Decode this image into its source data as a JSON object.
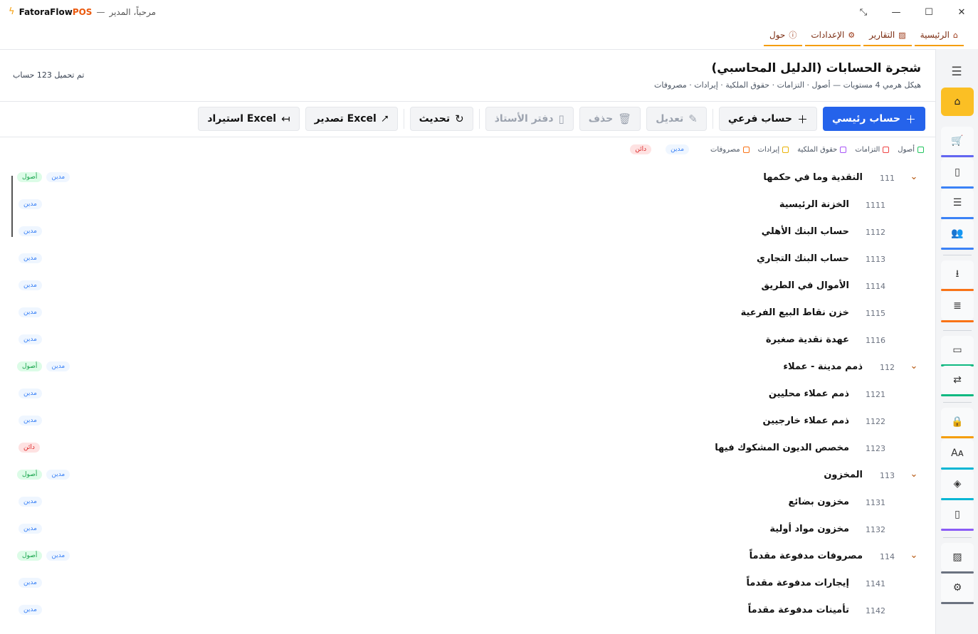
{
  "titlebar": {
    "app_name_1": "FatoraFlow",
    "app_name_2": "POS",
    "dash": "—",
    "welcome": "مرحباً، المدير",
    "controls": {
      "restore": "⤡",
      "minimize": "—",
      "maximize": "☐",
      "close": "✕"
    }
  },
  "menubar": [
    {
      "label": "الرئيسية",
      "icon": "⌂",
      "icon_name": "home-icon"
    },
    {
      "label": "التقارير",
      "icon": "▨",
      "icon_name": "report-icon"
    },
    {
      "label": "الإعدادات",
      "icon": "⚙",
      "icon_name": "gear-icon"
    },
    {
      "label": "حول",
      "icon": "ⓘ",
      "icon_name": "info-icon"
    }
  ],
  "page": {
    "title": "شجرة الحسابات (الدليل المحاسبي)",
    "subtitle": "هيكل هرمي 4 مستويات — أصول · التزامات · حقوق الملكية · إيرادات · مصروفات",
    "loaded_count": "تم تحميل 123 حساب"
  },
  "toolbar": {
    "add_main": "حساب رئيسي",
    "add_sub": "حساب فرعي",
    "edit": "تعديل",
    "delete": "حذف",
    "ledger": "دفتر الأستاذ",
    "refresh": "تحديث",
    "export": "تصدير Excel",
    "import": "استيراد Excel"
  },
  "legend": {
    "assets": "أصول",
    "liabilities": "التزامات",
    "equity": "حقوق الملكية",
    "revenue": "إيرادات",
    "expenses": "مصروفات",
    "debit": "مدين",
    "credit": "دائن",
    "colors": {
      "assets": "#22c55e",
      "liabilities": "#ef4444",
      "equity": "#a855f7",
      "revenue": "#eab308",
      "expenses": "#f97316"
    }
  },
  "accounts": [
    {
      "code": "111",
      "name": "النقدية وما في حكمها",
      "level": "group",
      "nature": "مدين",
      "type": "أصول"
    },
    {
      "code": "1111",
      "name": "الخزنة الرئيسية",
      "level": "sub",
      "nature": "مدين"
    },
    {
      "code": "1112",
      "name": "حساب البنك الأهلي",
      "level": "sub",
      "nature": "مدين"
    },
    {
      "code": "1113",
      "name": "حساب البنك التجاري",
      "level": "sub",
      "nature": "مدين"
    },
    {
      "code": "1114",
      "name": "الأموال في الطريق",
      "level": "sub",
      "nature": "مدين"
    },
    {
      "code": "1115",
      "name": "خزن نقاط البيع الفرعية",
      "level": "sub",
      "nature": "مدين"
    },
    {
      "code": "1116",
      "name": "عهدة نقدية صغيرة",
      "level": "sub",
      "nature": "مدين"
    },
    {
      "code": "112",
      "name": "ذمم مدينة - عملاء",
      "level": "group",
      "nature": "مدين",
      "type": "أصول"
    },
    {
      "code": "1121",
      "name": "ذمم عملاء محليين",
      "level": "sub",
      "nature": "مدين"
    },
    {
      "code": "1122",
      "name": "ذمم عملاء خارجيين",
      "level": "sub",
      "nature": "مدين"
    },
    {
      "code": "1123",
      "name": "مخصص الديون المشكوك فيها",
      "level": "sub",
      "nature": "دائن"
    },
    {
      "code": "113",
      "name": "المخزون",
      "level": "group",
      "nature": "مدين",
      "type": "أصول"
    },
    {
      "code": "1131",
      "name": "مخزون بضائع",
      "level": "sub",
      "nature": "مدين"
    },
    {
      "code": "1132",
      "name": "مخزون مواد أولية",
      "level": "sub",
      "nature": "مدين"
    },
    {
      "code": "114",
      "name": "مصروفات مدفوعة مقدماً",
      "level": "group",
      "nature": "مدين",
      "type": "أصول"
    },
    {
      "code": "1141",
      "name": "إيجارات مدفوعة مقدماً",
      "level": "sub",
      "nature": "مدين"
    },
    {
      "code": "1142",
      "name": "تأمينات مدفوعة مقدماً",
      "level": "sub",
      "nature": "مدين"
    }
  ],
  "sidebar": {
    "menu_icon": "☰",
    "items": [
      {
        "name": "home-icon",
        "glyph": "⌂",
        "color": "#f59e0b",
        "active": true
      },
      {
        "name": "cart-icon",
        "glyph": "🛒",
        "color": "#6366f1"
      },
      {
        "name": "document-icon",
        "glyph": "▯",
        "color": "#3b82f6"
      },
      {
        "name": "list-icon",
        "glyph": "☰",
        "color": "#3b82f6"
      },
      {
        "name": "users-icon",
        "glyph": "👥",
        "color": "#3b82f6"
      },
      {
        "name": "download-icon",
        "glyph": "⭳",
        "color": "#f97316"
      },
      {
        "name": "list-alt-icon",
        "glyph": "≣",
        "color": "#f97316"
      },
      {
        "name": "file-icon",
        "glyph": "▭",
        "color": "#10b981"
      },
      {
        "name": "shuffle-icon",
        "glyph": "⇄",
        "color": "#10b981"
      },
      {
        "name": "lock-icon",
        "glyph": "🔒",
        "color": "#f59e0b"
      },
      {
        "name": "translate-icon",
        "glyph": "Aᴀ",
        "color": "#06b6d4"
      },
      {
        "name": "layers-icon",
        "glyph": "◈",
        "color": "#06b6d4"
      },
      {
        "name": "clipboard-icon",
        "glyph": "▯",
        "color": "#8b5cf6"
      },
      {
        "name": "chart-icon",
        "glyph": "▨",
        "color": "#6b7280"
      },
      {
        "name": "settings-icon",
        "glyph": "⚙",
        "color": "#6b7280"
      }
    ]
  }
}
